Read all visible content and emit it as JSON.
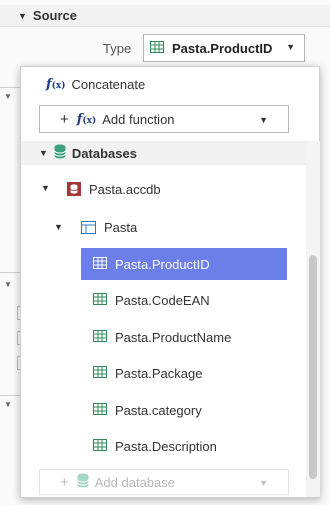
{
  "source_section": {
    "title": "Source"
  },
  "type_field": {
    "label": "Type",
    "value": "Pasta.ProductID"
  },
  "dropdown": {
    "concatenate_label": "Concatenate",
    "add_function_label": "Add function",
    "databases_label": "Databases",
    "database": {
      "name": "Pasta.accdb",
      "table": {
        "name": "Pasta",
        "fields": [
          {
            "label": "Pasta.ProductID",
            "selected": true
          },
          {
            "label": "Pasta.CodeEAN",
            "selected": false
          },
          {
            "label": "Pasta.ProductName",
            "selected": false
          },
          {
            "label": "Pasta.Package",
            "selected": false
          },
          {
            "label": "Pasta.category",
            "selected": false
          },
          {
            "label": "Pasta.Description",
            "selected": false
          }
        ]
      }
    },
    "add_database_label": "Add database"
  },
  "colors": {
    "selected_bg": "#6b7ee9",
    "table_icon": "#2e8b57",
    "db_icon": "#3aa37b",
    "accdb_icon": "#a4373a",
    "fx_icon": "#1f3c88"
  }
}
